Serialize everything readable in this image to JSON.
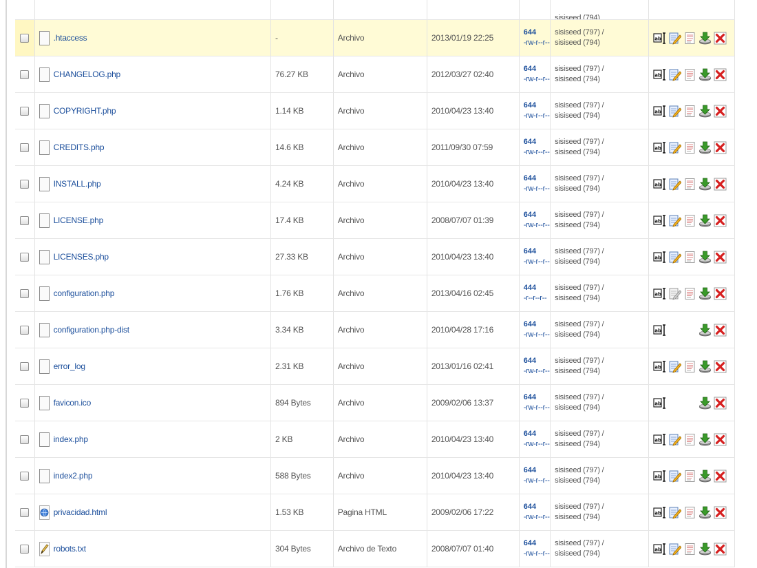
{
  "partial_row": {
    "owner": "sisiseed (794)"
  },
  "rows": [
    {
      "name": ".htaccess",
      "size": "-",
      "type": "Archivo",
      "date": "2013/01/19 22:25",
      "perm_octal": "644",
      "perm_sym": "-rw-r--r--",
      "owner_user": "sisiseed (797) /",
      "owner_group": "sisiseed (794)",
      "icon": "file",
      "highlight": true,
      "actions": "full"
    },
    {
      "name": "CHANGELOG.php",
      "size": "76.27 KB",
      "type": "Archivo",
      "date": "2012/03/27 02:40",
      "perm_octal": "644",
      "perm_sym": "-rw-r--r--",
      "owner_user": "sisiseed (797) /",
      "owner_group": "sisiseed (794)",
      "icon": "file",
      "actions": "full"
    },
    {
      "name": "COPYRIGHT.php",
      "size": "1.14 KB",
      "type": "Archivo",
      "date": "2010/04/23 13:40",
      "perm_octal": "644",
      "perm_sym": "-rw-r--r--",
      "owner_user": "sisiseed (797) /",
      "owner_group": "sisiseed (794)",
      "icon": "file",
      "actions": "full"
    },
    {
      "name": "CREDITS.php",
      "size": "14.6 KB",
      "type": "Archivo",
      "date": "2011/09/30 07:59",
      "perm_octal": "644",
      "perm_sym": "-rw-r--r--",
      "owner_user": "sisiseed (797) /",
      "owner_group": "sisiseed (794)",
      "icon": "file",
      "actions": "full"
    },
    {
      "name": "INSTALL.php",
      "size": "4.24 KB",
      "type": "Archivo",
      "date": "2010/04/23 13:40",
      "perm_octal": "644",
      "perm_sym": "-rw-r--r--",
      "owner_user": "sisiseed (797) /",
      "owner_group": "sisiseed (794)",
      "icon": "file",
      "actions": "full"
    },
    {
      "name": "LICENSE.php",
      "size": "17.4 KB",
      "type": "Archivo",
      "date": "2008/07/07 01:39",
      "perm_octal": "644",
      "perm_sym": "-rw-r--r--",
      "owner_user": "sisiseed (797) /",
      "owner_group": "sisiseed (794)",
      "icon": "file",
      "actions": "full"
    },
    {
      "name": "LICENSES.php",
      "size": "27.33 KB",
      "type": "Archivo",
      "date": "2010/04/23 13:40",
      "perm_octal": "644",
      "perm_sym": "-rw-r--r--",
      "owner_user": "sisiseed (797) /",
      "owner_group": "sisiseed (794)",
      "icon": "file",
      "actions": "full"
    },
    {
      "name": "configuration.php",
      "size": "1.76 KB",
      "type": "Archivo",
      "date": "2013/04/16 02:45",
      "perm_octal": "444",
      "perm_sym": "-r--r--r--",
      "owner_user": "sisiseed (797) /",
      "owner_group": "sisiseed (794)",
      "icon": "file",
      "actions": "readonly"
    },
    {
      "name": "configuration.php-dist",
      "size": "3.34 KB",
      "type": "Archivo",
      "date": "2010/04/28 17:16",
      "perm_octal": "644",
      "perm_sym": "-rw-r--r--",
      "owner_user": "sisiseed (797) /",
      "owner_group": "sisiseed (794)",
      "icon": "file",
      "actions": "limited"
    },
    {
      "name": "error_log",
      "size": "2.31 KB",
      "type": "Archivo",
      "date": "2013/01/16 02:41",
      "perm_octal": "644",
      "perm_sym": "-rw-r--r--",
      "owner_user": "sisiseed (797) /",
      "owner_group": "sisiseed (794)",
      "icon": "file",
      "actions": "full"
    },
    {
      "name": "favicon.ico",
      "size": "894 Bytes",
      "type": "Archivo",
      "date": "2009/02/06 13:37",
      "perm_octal": "644",
      "perm_sym": "-rw-r--r--",
      "owner_user": "sisiseed (797) /",
      "owner_group": "sisiseed (794)",
      "icon": "file",
      "actions": "limited"
    },
    {
      "name": "index.php",
      "size": "2 KB",
      "type": "Archivo",
      "date": "2010/04/23 13:40",
      "perm_octal": "644",
      "perm_sym": "-rw-r--r--",
      "owner_user": "sisiseed (797) /",
      "owner_group": "sisiseed (794)",
      "icon": "file",
      "actions": "full"
    },
    {
      "name": "index2.php",
      "size": "588 Bytes",
      "type": "Archivo",
      "date": "2010/04/23 13:40",
      "perm_octal": "644",
      "perm_sym": "-rw-r--r--",
      "owner_user": "sisiseed (797) /",
      "owner_group": "sisiseed (794)",
      "icon": "file",
      "actions": "full"
    },
    {
      "name": "privacidad.html",
      "size": "1.53 KB",
      "type": "Pagina HTML",
      "date": "2009/02/06 17:22",
      "perm_octal": "644",
      "perm_sym": "-rw-r--r--",
      "owner_user": "sisiseed (797) /",
      "owner_group": "sisiseed (794)",
      "icon": "html",
      "actions": "full"
    },
    {
      "name": "robots.txt",
      "size": "304 Bytes",
      "type": "Archivo de Texto",
      "date": "2008/07/07 01:40",
      "perm_octal": "644",
      "perm_sym": "-rw-r--r--",
      "owner_user": "sisiseed (797) /",
      "owner_group": "sisiseed (794)",
      "icon": "txt",
      "actions": "full"
    }
  ],
  "action_icons": [
    "rename-icon",
    "edit-icon",
    "view-icon",
    "download-icon",
    "delete-icon"
  ],
  "colors": {
    "link": "#1b4e9b",
    "highlight_row": "#fffbd6",
    "delete_red": "#d62020",
    "download_green": "#3a9a2a"
  }
}
